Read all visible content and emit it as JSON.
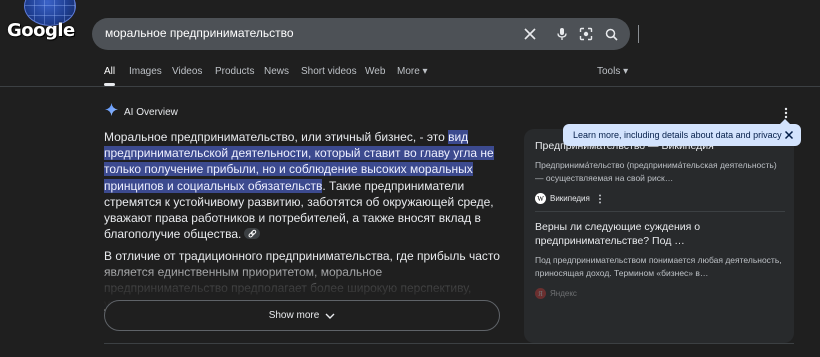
{
  "header": {
    "logo_text": "Google",
    "search": {
      "query": "моральное предпринимательство"
    },
    "icons": [
      "clear-icon",
      "mic-icon",
      "lens-icon",
      "search-icon"
    ]
  },
  "tabs": [
    {
      "label": "All",
      "active": true
    },
    {
      "label": "Images"
    },
    {
      "label": "Videos"
    },
    {
      "label": "Products"
    },
    {
      "label": "News"
    },
    {
      "label": "Short videos"
    },
    {
      "label": "Web"
    },
    {
      "label": "More ▾"
    }
  ],
  "tools_label": "Tools ▾",
  "ai_overview": {
    "label": "AI Overview",
    "p1_before": "Моральное предпринимательство, или этичный бизнес, - это ",
    "p1_highlight": "вид предпринимательской деятельности, который ставит во главу угла не только получение прибыли, но и соблюдение высоких моральных принципов и социальных обязательств",
    "p1_after": ". Такие предприниматели стремятся к устойчивому развитию, заботятся об окружающей среде, уважают права работников и потребителей, а также вносят вклад в благополучие общества.",
    "p2": "В отличие от традиционного предпринимательства, где прибыль часто является единственным приоритетом, моральное предпринимательство предполагает более широкую перспективу, учитывающую долгосрочные",
    "show_more": "Show more"
  },
  "tooltip": {
    "text": "Learn more, including details about data and privacy"
  },
  "sources": [
    {
      "title": "Предпринимательство — Википедия",
      "snippet": "Предпринима́тельство (предпринима́тельская деятельность) — осуществляемая на свой риск…",
      "site": "Википедия"
    },
    {
      "title": "Верны ли следующие суждения о предпринимательстве? Под …",
      "snippet": "Под предпринимательством понимается любая деятельность, приносящая доход. Термином «бизнес» в…",
      "site": "Яндекс"
    }
  ],
  "colors": {
    "background": "#1f1f1f",
    "highlight": "#3c4a8f",
    "tooltip": "#d3e3fd"
  }
}
